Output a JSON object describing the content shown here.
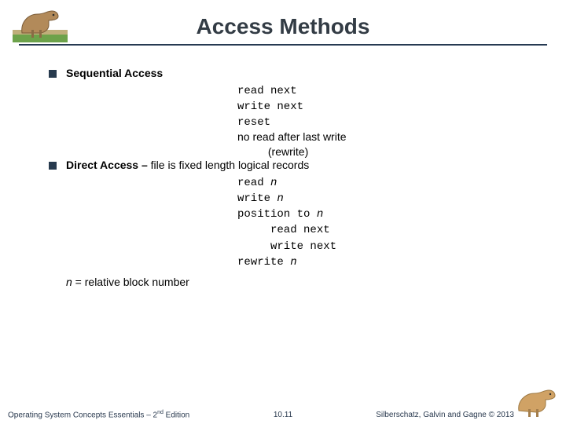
{
  "title": "Access Methods",
  "bullets": {
    "seq": {
      "label": "Sequential Access",
      "ops": {
        "l1": "read next",
        "l2": "write next",
        "l3": "reset",
        "l4": "no read after last write",
        "l5": "          (rewrite)"
      }
    },
    "direct": {
      "label": "Direct Access – ",
      "desc_plain1": "file is fixed length ",
      "desc_em": "logical records",
      "ops": {
        "l1a": "read ",
        "l1n": "n",
        "l2a": "write ",
        "l2n": "n",
        "l3a": "position to ",
        "l3n": "n",
        "l4": "     read next",
        "l5": "     write next",
        "l6a": "rewrite ",
        "l6n": "n"
      },
      "note_n": "n",
      "note_rest": " = relative block number"
    }
  },
  "footer": {
    "left_a": "Operating System Concepts Essentials – 2",
    "left_sup": "nd",
    "left_b": " Edition",
    "center": "10.11",
    "right": "Silberschatz, Galvin and Gagne © 2013"
  }
}
